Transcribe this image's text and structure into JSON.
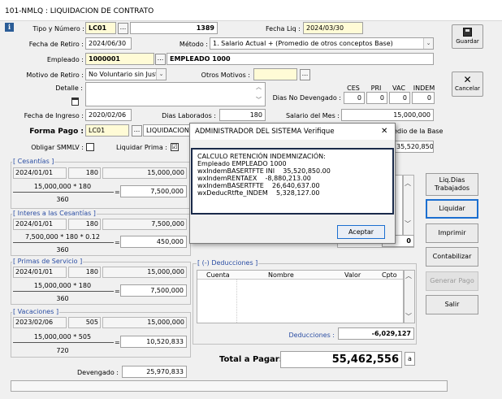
{
  "window": {
    "title": "101-NMLQ : LIQUIDACION DE CONTRATO"
  },
  "form": {
    "tipo_label": "Tipo y Número :",
    "tipo_value": "LC01",
    "numero_value": "1389",
    "fecha_liq_label": "Fecha Liq :",
    "fecha_liq_value": "2024/03/30",
    "fecha_retiro_label": "Fecha de Retiro :",
    "fecha_retiro_value": "2024/06/30",
    "metodo_label": "Método :",
    "metodo_value": "1. Salario Actual + (Promedio de otros conceptos Base)",
    "empleado_label": "Empleado :",
    "empleado_code": "1000001",
    "empleado_name": "EMPLEADO 1000",
    "motivo_label": "Motivo de Retiro :",
    "motivo_value": "No Voluntario sin Justa",
    "otros_motivos_label": "Otros Motivos :",
    "detalle_label": "Detalle :",
    "dias_no_dev_label": "Dias No Devengado :",
    "ces_label": "CES",
    "pri_label": "PRI",
    "vac_label": "VAC",
    "indem_label": "INDEM",
    "ces_value": "0",
    "pri_value": "0",
    "vac_value": "0",
    "indem_value": "0",
    "fecha_ingreso_label": "Fecha de Ingreso :",
    "fecha_ingreso_value": "2020/02/06",
    "dias_lab_label": "Dias Laborados :",
    "dias_lab_value": "180",
    "salario_mes_label": "Salario del Mes :",
    "salario_mes_value": "15,000,000",
    "forma_pago_label": "Forma Pago :",
    "forma_pago_code": "LC01",
    "forma_pago_name": "LIQUIDACION",
    "promedio_label": "redio de la Base",
    "promedio_value": "35,520,850",
    "obligar_label": "Obligar SMMLV :",
    "liquidar_prima_label": "Liquidar Prima :",
    "liquidar_prima_check": "☑",
    "dots": "..."
  },
  "cesantias": {
    "title": "[ Cesantías ]",
    "date": "2024/01/01",
    "days": "180",
    "base": "15,000,000",
    "formula": "15,000,000 * 180",
    "divisor": "360",
    "eq": "=",
    "result": "7,500,000"
  },
  "intereses": {
    "title": "[ Interes a las Cesantías ]",
    "date": "2024/01/01",
    "days": "180",
    "base": "7,500,000",
    "formula": "7,500,000 * 180 * 0.12",
    "divisor": "360",
    "eq": "=",
    "result": "450,000"
  },
  "primas": {
    "title": "[ Primas de Servicio ]",
    "date": "2024/01/01",
    "days": "180",
    "base": "15,000,000",
    "formula": "15,000,000 * 180",
    "divisor": "360",
    "eq": "=",
    "result": "7,500,000"
  },
  "vacaciones": {
    "title": "[ Vacaciones ]",
    "date": "2023/02/06",
    "days": "505",
    "base": "15,000,000",
    "formula": "15,000,000 * 505",
    "divisor": "720",
    "eq": "=",
    "result": "10,520,833"
  },
  "devengado": {
    "label": "Devengado :",
    "value": "25,970,833"
  },
  "deducciones": {
    "title": "[ (-) Deducciones ]",
    "columns": [
      "Cuenta",
      "Nombre",
      "Valor",
      "Cpto"
    ],
    "total_label": "Deducciones :",
    "total_value": "-6,029,127"
  },
  "devengos_partial": {
    "value": "0"
  },
  "total": {
    "label": "Total a Pagar:",
    "value": "55,462,556",
    "suffix": "a"
  },
  "buttons": {
    "guardar": "Guardar",
    "cancelar": "Cancelar",
    "liq_dias": "Liq.Dias Trabajados",
    "liquidar": "Liquidar",
    "imprimir": "Imprimir",
    "contabilizar": "Contabilizar",
    "generar_pago": "Generar Pago",
    "salir": "Salir"
  },
  "dialog": {
    "title": "ADMINISTRADOR DEL SISTEMA Verifique",
    "close": "✕",
    "lines": [
      "CALCULO RETENCIÓN INDEMNIZACIÓN:",
      "Empleado EMPLEADO 1000",
      "wxIndemBASERTFTE INI    35,520,850.00",
      "wxIndemRENTAEX    -8,880,213.00",
      "wxIndemBASERTFTE    26,640,637.00",
      "wxDeducRtfte_INDEM    5,328,127.00"
    ],
    "accept": "Aceptar"
  },
  "colors": {
    "accent": "#1c6fd0",
    "dialog_border": "#1a2a4a",
    "yellow": "#fffbd6",
    "group_title": "#2a4da3"
  }
}
